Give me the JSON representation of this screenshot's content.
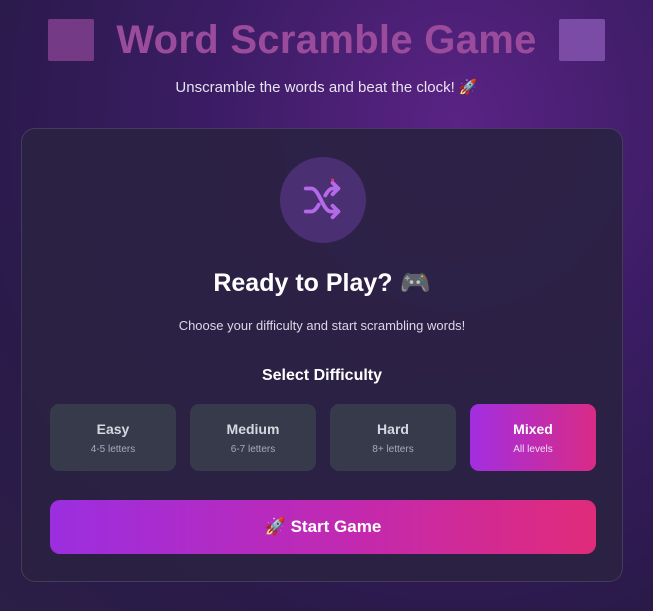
{
  "header": {
    "title": "Word Scramble Game",
    "subtitle": "Unscramble the words and beat the clock! 🚀"
  },
  "card": {
    "icon": "shuffle-icon",
    "heading": "Ready to Play? 🎮",
    "description": "Choose your difficulty and start scrambling words!",
    "select_label": "Select Difficulty",
    "difficulties": [
      {
        "name": "Easy",
        "detail": "4-5 letters",
        "selected": false
      },
      {
        "name": "Medium",
        "detail": "6-7 letters",
        "selected": false
      },
      {
        "name": "Hard",
        "detail": "8+ letters",
        "selected": false
      },
      {
        "name": "Mixed",
        "detail": "All levels",
        "selected": true
      }
    ],
    "start_label": "🚀 Start Game"
  },
  "colors": {
    "accent_start": "#a22ee0",
    "accent_end": "#e02b7a",
    "title": "#9b4b9b"
  }
}
